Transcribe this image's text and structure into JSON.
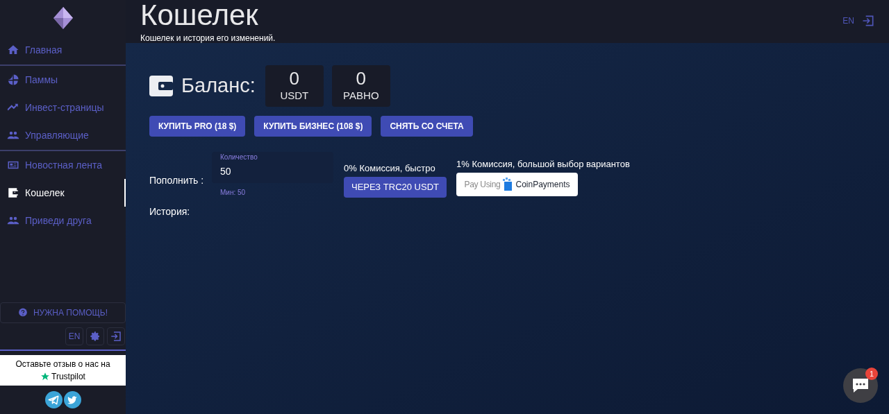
{
  "header": {
    "title": "Кошелек",
    "subtitle": "Кошелек и история его изменений.",
    "language": "EN"
  },
  "sidebar": {
    "groups": [
      [
        {
          "label": "Главная",
          "selected": false
        }
      ],
      [
        {
          "label": "Паммы",
          "selected": false
        },
        {
          "label": "Инвест-страницы",
          "selected": false
        },
        {
          "label": "Управляющие",
          "selected": false
        }
      ],
      [
        {
          "label": "Новостная лента",
          "selected": false
        },
        {
          "label": "Кошелек",
          "selected": true
        },
        {
          "label": "Приведи друга",
          "selected": false
        }
      ]
    ],
    "help_button": "НУЖНА ПОМОЩЬ!",
    "language": "EN",
    "review": {
      "text": "Оставьте отзыв о нас на",
      "brand": "Trustpilot"
    }
  },
  "balance": {
    "label": "Баланс:",
    "amounts": [
      {
        "value": "0",
        "unit": "USDT"
      },
      {
        "value": "0",
        "unit": "РАВНО"
      }
    ]
  },
  "actions": [
    "КУПИТЬ PRO (18 $)",
    "КУПИТЬ БИЗНЕС (108 $)",
    "СНЯТЬ СО СЧЕТА"
  ],
  "top_up": {
    "label": "Пополнить :",
    "field_label": "Количество",
    "value": "50",
    "hint": "Мин: 50",
    "trc20": {
      "note": "0% Комиссия, быстро",
      "button": "ЧЕРЕЗ TRC20 USDT"
    },
    "coinpayments": {
      "note": "1% Комиссия, большой выбор вариантов",
      "prefix": "Pay Using",
      "brand": "CoinPayments"
    }
  },
  "history": {
    "label": "История:"
  },
  "chat": {
    "badge": "1"
  }
}
